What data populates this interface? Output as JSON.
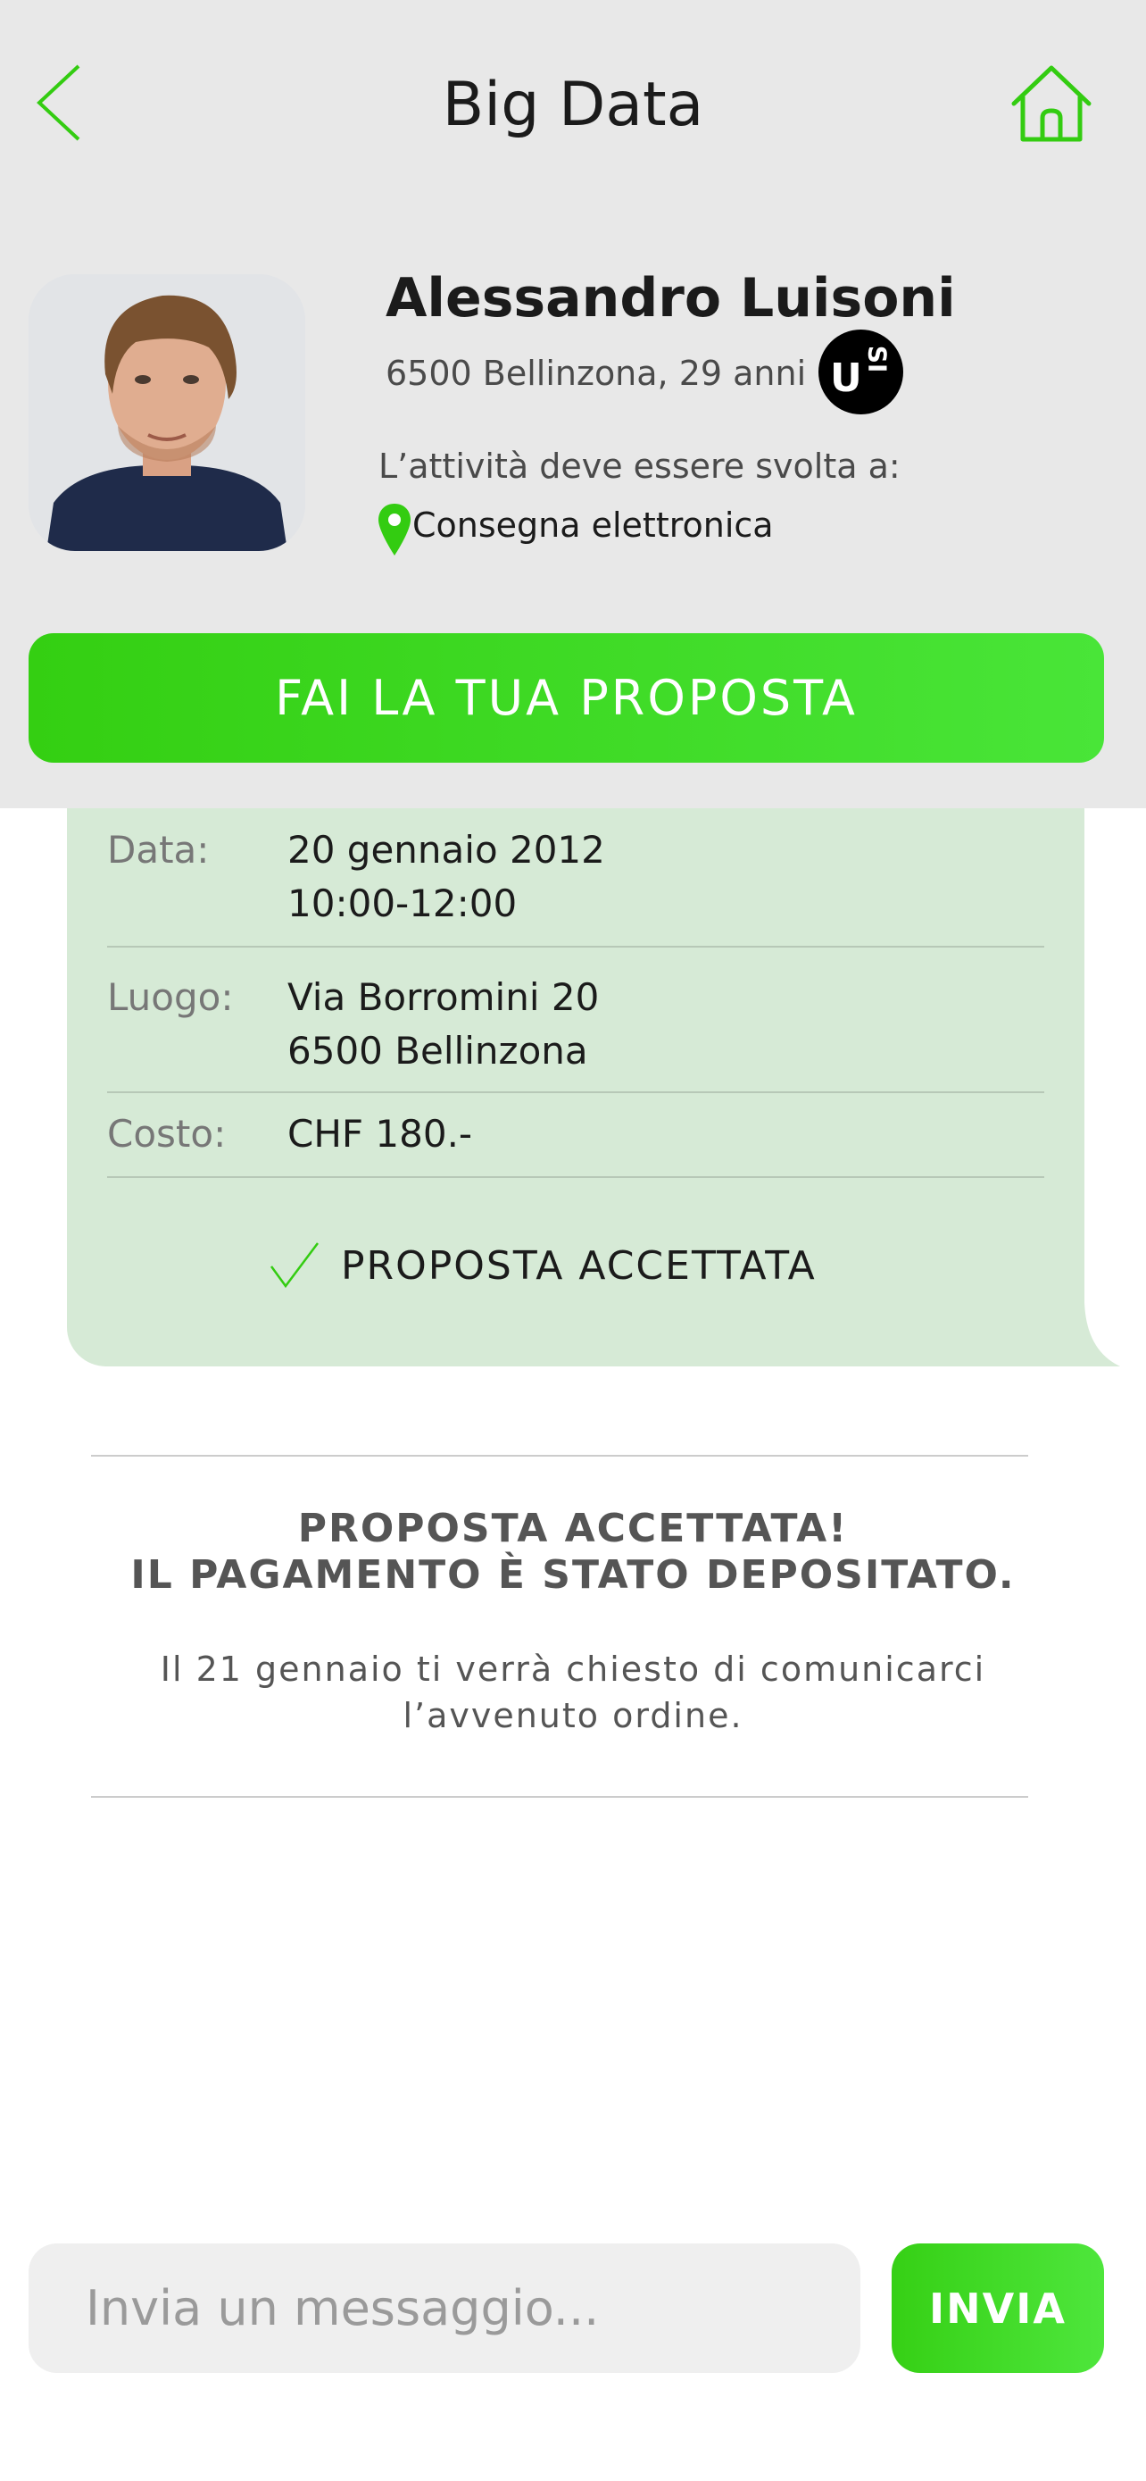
{
  "header": {
    "title": "Big Data",
    "back_icon": "chevron-left-icon",
    "home_icon": "home-icon",
    "accent_color": "#33cc11"
  },
  "profile": {
    "name": "Alessandro Luisoni",
    "location_age": "6500 Bellinzona, 29 anni",
    "university_logo": {
      "u": "U",
      "si": "SI"
    },
    "activity_label": "L’attività deve essere svolta a:",
    "delivery": "Consegna elettronica",
    "delivery_icon": "map-pin-icon"
  },
  "cta": {
    "label": "FAI LA TUA PROPOSTA"
  },
  "proposal": {
    "date_label": "Data:",
    "date_value": "20 gennaio 2012",
    "time_value": "10:00-12:00",
    "place_label": "Luogo:",
    "place_line1": "Via Borromini 20",
    "place_line2": "6500 Bellinzona",
    "cost_label": "Costo:",
    "cost_value": "CHF 180.-",
    "status": "PROPOSTA ACCETTATA",
    "status_icon": "check-icon",
    "background_color": "#d6ead6"
  },
  "notice": {
    "title_line1": "PROPOSTA ACCETTATA!",
    "title_line2": "IL PAGAMENTO È STATO DEPOSITATO.",
    "body_line1": "Il 21 gennaio ti verrà chiesto di comunicarci",
    "body_line2": "l’avvenuto ordine."
  },
  "composer": {
    "placeholder": "Invia un messaggio...",
    "value": "",
    "send_label": "INVIA"
  }
}
